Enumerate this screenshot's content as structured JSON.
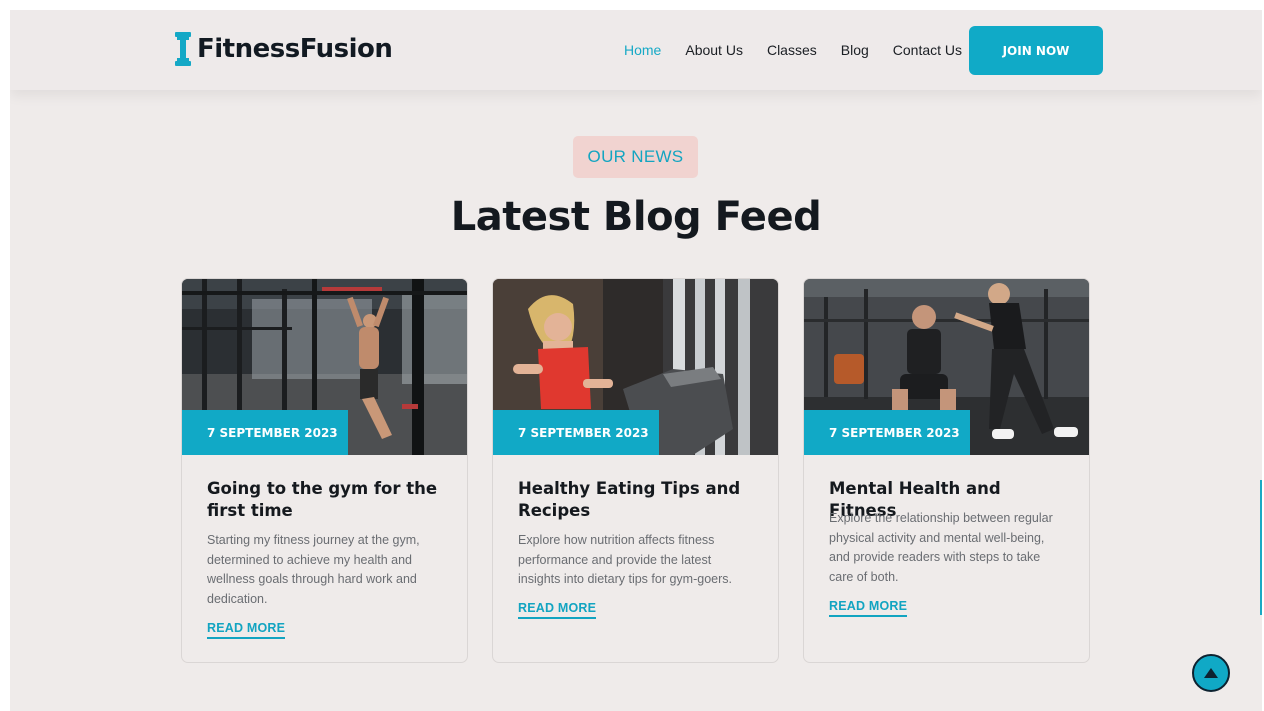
{
  "brand": {
    "name": "FitnessFusion",
    "accent": "#10aac7"
  },
  "nav": {
    "items": [
      {
        "label": "Home",
        "active": true
      },
      {
        "label": "About Us",
        "active": false
      },
      {
        "label": "Classes",
        "active": false
      },
      {
        "label": "Blog",
        "active": false
      },
      {
        "label": "Contact Us",
        "active": false
      }
    ],
    "cta": "JOIN NOW"
  },
  "section": {
    "badge": "OUR NEWS",
    "title": "Latest Blog Feed"
  },
  "posts": [
    {
      "date": "7 SEPTEMBER 2023",
      "title": "Going to the gym for the first time",
      "excerpt": "Starting my fitness journey at the gym, determined to achieve my health and wellness goals through hard work and dedication.",
      "link": "READ MORE",
      "image": "gym-pullup-photo"
    },
    {
      "date": "7 SEPTEMBER 2023",
      "title": "Healthy Eating Tips and Recipes",
      "excerpt": "Explore how nutrition affects fitness performance and provide the latest insights into dietary tips for gym-goers.",
      "link": "READ MORE",
      "image": "treadmill-runner-photo"
    },
    {
      "date": "7 SEPTEMBER 2023",
      "title": "Mental Health and Fitness",
      "excerpt": "Explore the relationship between regular physical activity and mental well-being, and provide readers with steps to take care of both.",
      "link": "READ MORE",
      "image": "gym-couple-photo"
    }
  ],
  "scroll_top": {
    "icon": "arrow-up-icon"
  }
}
